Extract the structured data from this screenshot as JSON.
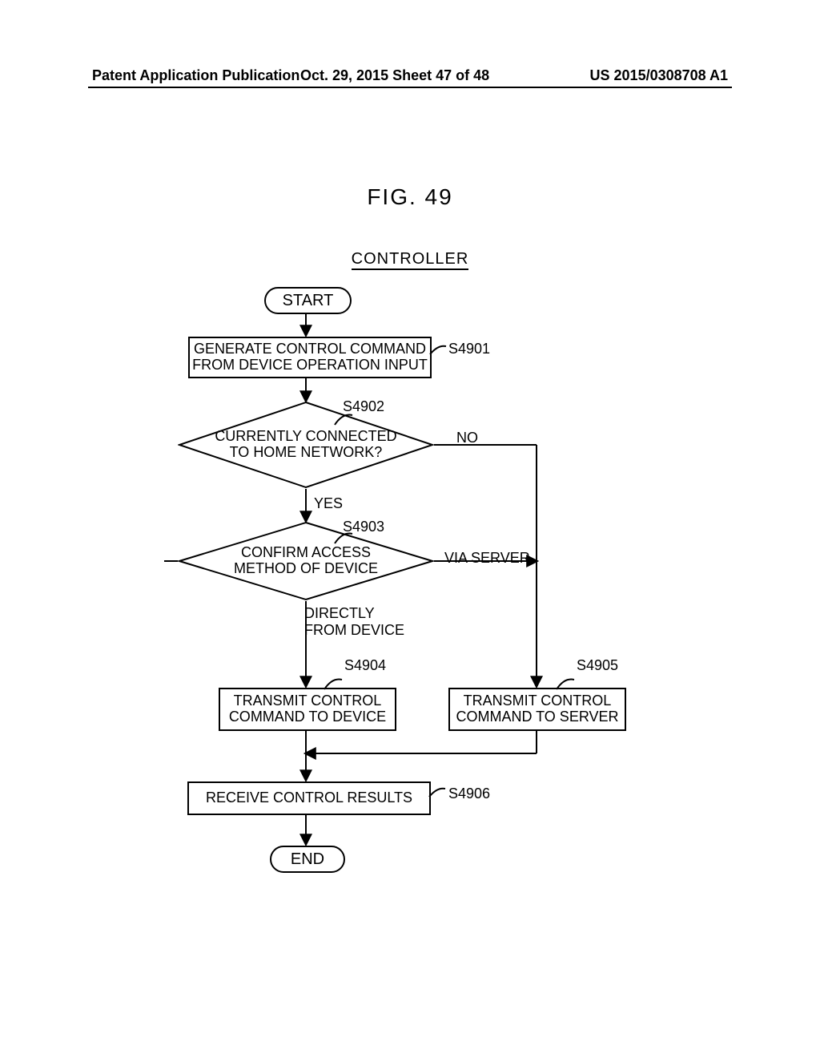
{
  "header": {
    "left": "Patent Application Publication",
    "center": "Oct. 29, 2015  Sheet 47 of 48",
    "right": "US 2015/0308708 A1"
  },
  "figure": {
    "title": "FIG. 49",
    "subject": "CONTROLLER"
  },
  "nodes": {
    "start": "START",
    "end": "END",
    "s4901": "GENERATE CONTROL COMMAND\nFROM DEVICE OPERATION INPUT",
    "s4902": "CURRENTLY CONNECTED\nTO HOME NETWORK?",
    "s4903": "CONFIRM ACCESS\nMETHOD OF DEVICE",
    "s4904": "TRANSMIT CONTROL\nCOMMAND TO DEVICE",
    "s4905": "TRANSMIT CONTROL\nCOMMAND TO SERVER",
    "s4906": "RECEIVE CONTROL RESULTS"
  },
  "edge_labels": {
    "s4902_yes": "YES",
    "s4902_no": "NO",
    "s4903_left": "DIRECTLY\nFROM DEVICE",
    "s4903_right": "VIA SERVER"
  },
  "step_refs": {
    "s4901": "S4901",
    "s4902": "S4902",
    "s4903": "S4903",
    "s4904": "S4904",
    "s4905": "S4905",
    "s4906": "S4906"
  }
}
